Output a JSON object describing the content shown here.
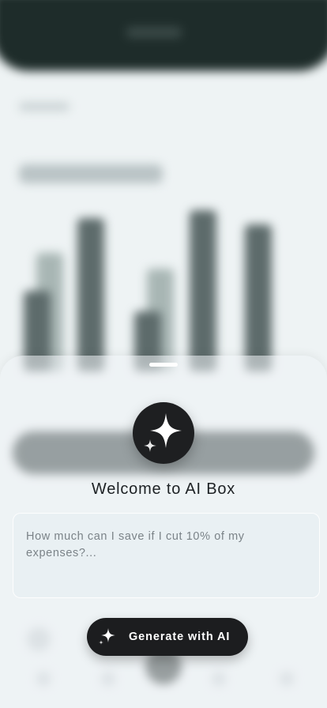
{
  "sheet": {
    "title": "Welcome to AI Box",
    "prompt_placeholder": "How much can I save if I cut 10% of my expenses?...",
    "generate_label": "Generate with AI",
    "icons": {
      "badge": "sparkle-icon",
      "button": "sparkle-icon"
    }
  },
  "colors": {
    "button_bg": "#1c1d1f",
    "header_bg": "#1e2c2a",
    "text": "#1d2124"
  }
}
